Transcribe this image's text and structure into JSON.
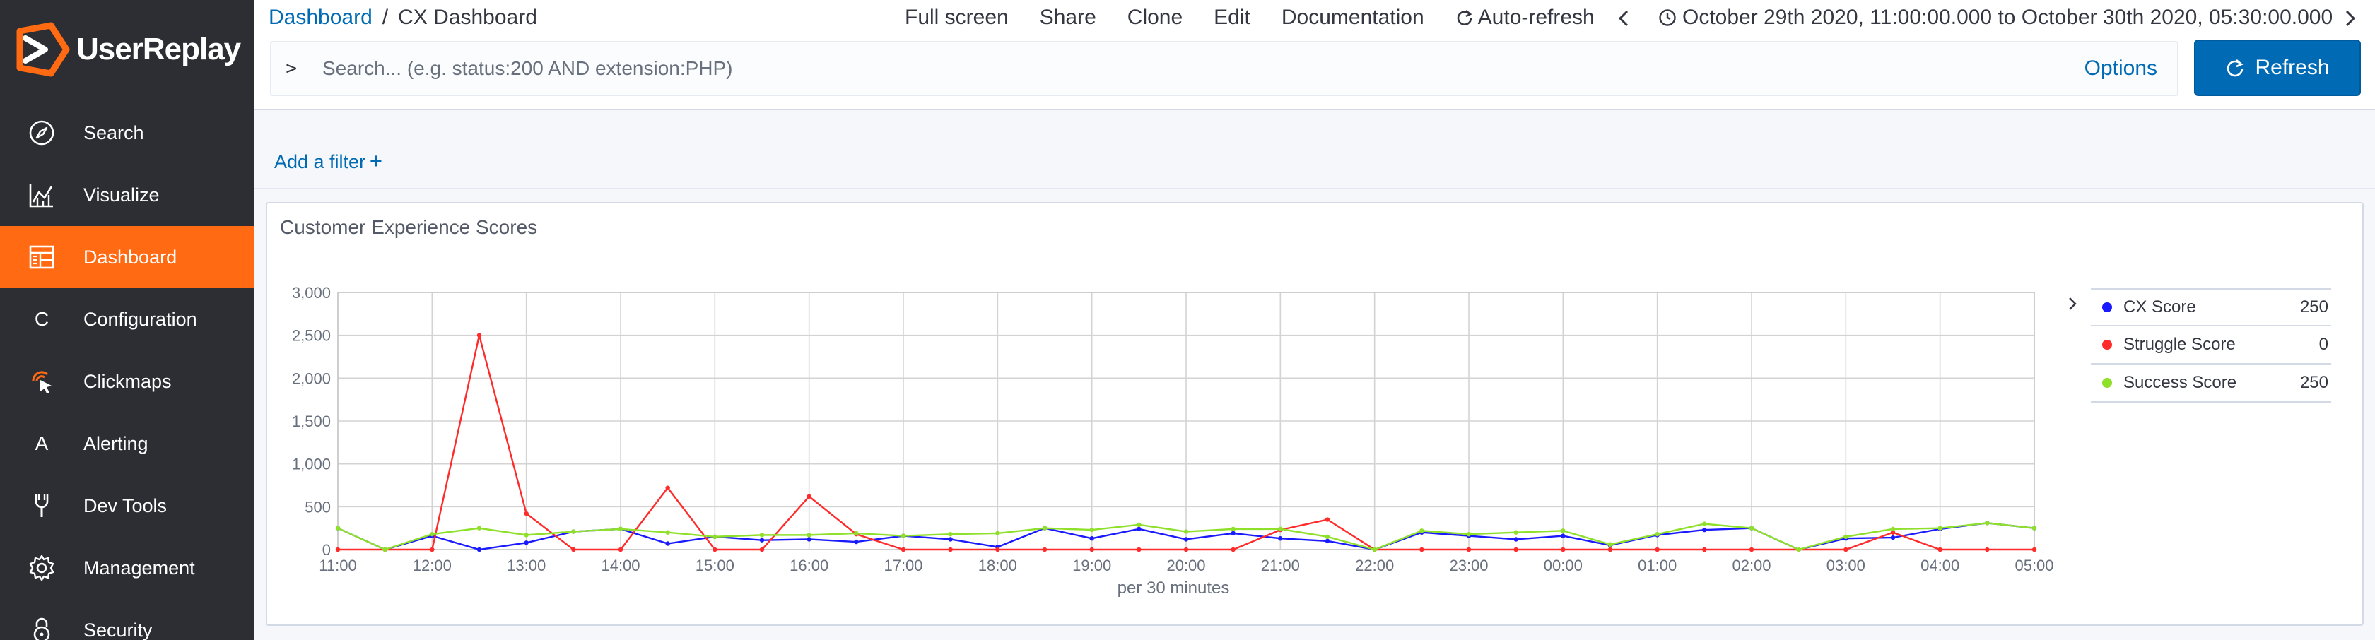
{
  "app": {
    "logo_text": "UserReplay",
    "brand_color": "#ff6a13"
  },
  "sidebar": {
    "items": [
      {
        "label": "Search",
        "icon": "compass-icon",
        "active": false
      },
      {
        "label": "Visualize",
        "icon": "chart-icon",
        "active": false
      },
      {
        "label": "Dashboard",
        "icon": "dashboard-icon",
        "active": true
      },
      {
        "label": "Configuration",
        "icon": "C",
        "active": false
      },
      {
        "label": "Clickmaps",
        "icon": "pointer-icon",
        "active": false
      },
      {
        "label": "Alerting",
        "icon": "A",
        "active": false
      },
      {
        "label": "Dev Tools",
        "icon": "wrench-icon",
        "active": false
      },
      {
        "label": "Management",
        "icon": "gear-icon",
        "active": false
      },
      {
        "label": "Security",
        "icon": "lock-icon",
        "active": false
      }
    ]
  },
  "topbar": {
    "breadcrumb_link": "Dashboard",
    "breadcrumb_sep": "/",
    "breadcrumb_current": "CX Dashboard",
    "menu": {
      "full_screen": "Full screen",
      "share": "Share",
      "clone": "Clone",
      "edit": "Edit",
      "documentation": "Documentation",
      "auto_refresh": "Auto-refresh"
    },
    "time_range": "October 29th 2020, 11:00:00.000 to October 30th 2020, 05:30:00.000"
  },
  "query": {
    "prompt": ">_",
    "placeholder": "Search... (e.g. status:200 AND extension:PHP)",
    "options_label": "Options",
    "refresh_label": "Refresh"
  },
  "filters": {
    "add_filter_label": "Add a filter",
    "add_filter_plus": "+"
  },
  "panel": {
    "title": "Customer Experience Scores"
  },
  "chart_data": {
    "type": "line",
    "title": "Customer Experience Scores",
    "xlabel": "per 30 minutes",
    "ylabel": "",
    "ylim": [
      0,
      3000
    ],
    "yticks": [
      "0",
      "500",
      "1,000",
      "1,500",
      "2,000",
      "2,500",
      "3,000"
    ],
    "x": [
      "11:00",
      "11:30",
      "12:00",
      "12:30",
      "13:00",
      "13:30",
      "14:00",
      "14:30",
      "15:00",
      "15:30",
      "16:00",
      "16:30",
      "17:00",
      "17:30",
      "18:00",
      "18:30",
      "19:00",
      "19:30",
      "20:00",
      "20:30",
      "21:00",
      "21:30",
      "22:00",
      "22:30",
      "23:00",
      "23:30",
      "00:00",
      "00:30",
      "01:00",
      "01:30",
      "02:00",
      "02:30",
      "03:00",
      "03:30",
      "04:00",
      "04:30",
      "05:00"
    ],
    "xticks": [
      "11:00",
      "12:00",
      "13:00",
      "14:00",
      "15:00",
      "16:00",
      "17:00",
      "18:00",
      "19:00",
      "20:00",
      "21:00",
      "22:00",
      "23:00",
      "00:00",
      "01:00",
      "02:00",
      "03:00",
      "04:00",
      "05:00"
    ],
    "grid": true,
    "legend_position": "right",
    "series": [
      {
        "name": "CX Score",
        "color": "#1a1aff",
        "legend_value": "250",
        "values": [
          250,
          0,
          160,
          0,
          80,
          210,
          240,
          70,
          150,
          110,
          120,
          90,
          160,
          120,
          30,
          250,
          130,
          240,
          120,
          190,
          130,
          100,
          0,
          200,
          160,
          120,
          160,
          50,
          170,
          230,
          250,
          0,
          130,
          140,
          240,
          310,
          250
        ]
      },
      {
        "name": "Struggle Score",
        "color": "#ff2b2b",
        "legend_value": "0",
        "values": [
          0,
          0,
          0,
          2500,
          420,
          0,
          0,
          720,
          0,
          0,
          620,
          180,
          0,
          0,
          0,
          0,
          0,
          0,
          0,
          0,
          230,
          350,
          0,
          0,
          0,
          0,
          0,
          0,
          0,
          0,
          0,
          0,
          0,
          200,
          0,
          0,
          0
        ]
      },
      {
        "name": "Success Score",
        "color": "#8fe02a",
        "legend_value": "250",
        "values": [
          250,
          0,
          180,
          250,
          170,
          210,
          240,
          200,
          150,
          170,
          170,
          190,
          160,
          180,
          190,
          250,
          230,
          290,
          210,
          240,
          240,
          150,
          0,
          220,
          180,
          200,
          220,
          60,
          180,
          300,
          250,
          0,
          150,
          240,
          250,
          310,
          250
        ]
      }
    ]
  }
}
